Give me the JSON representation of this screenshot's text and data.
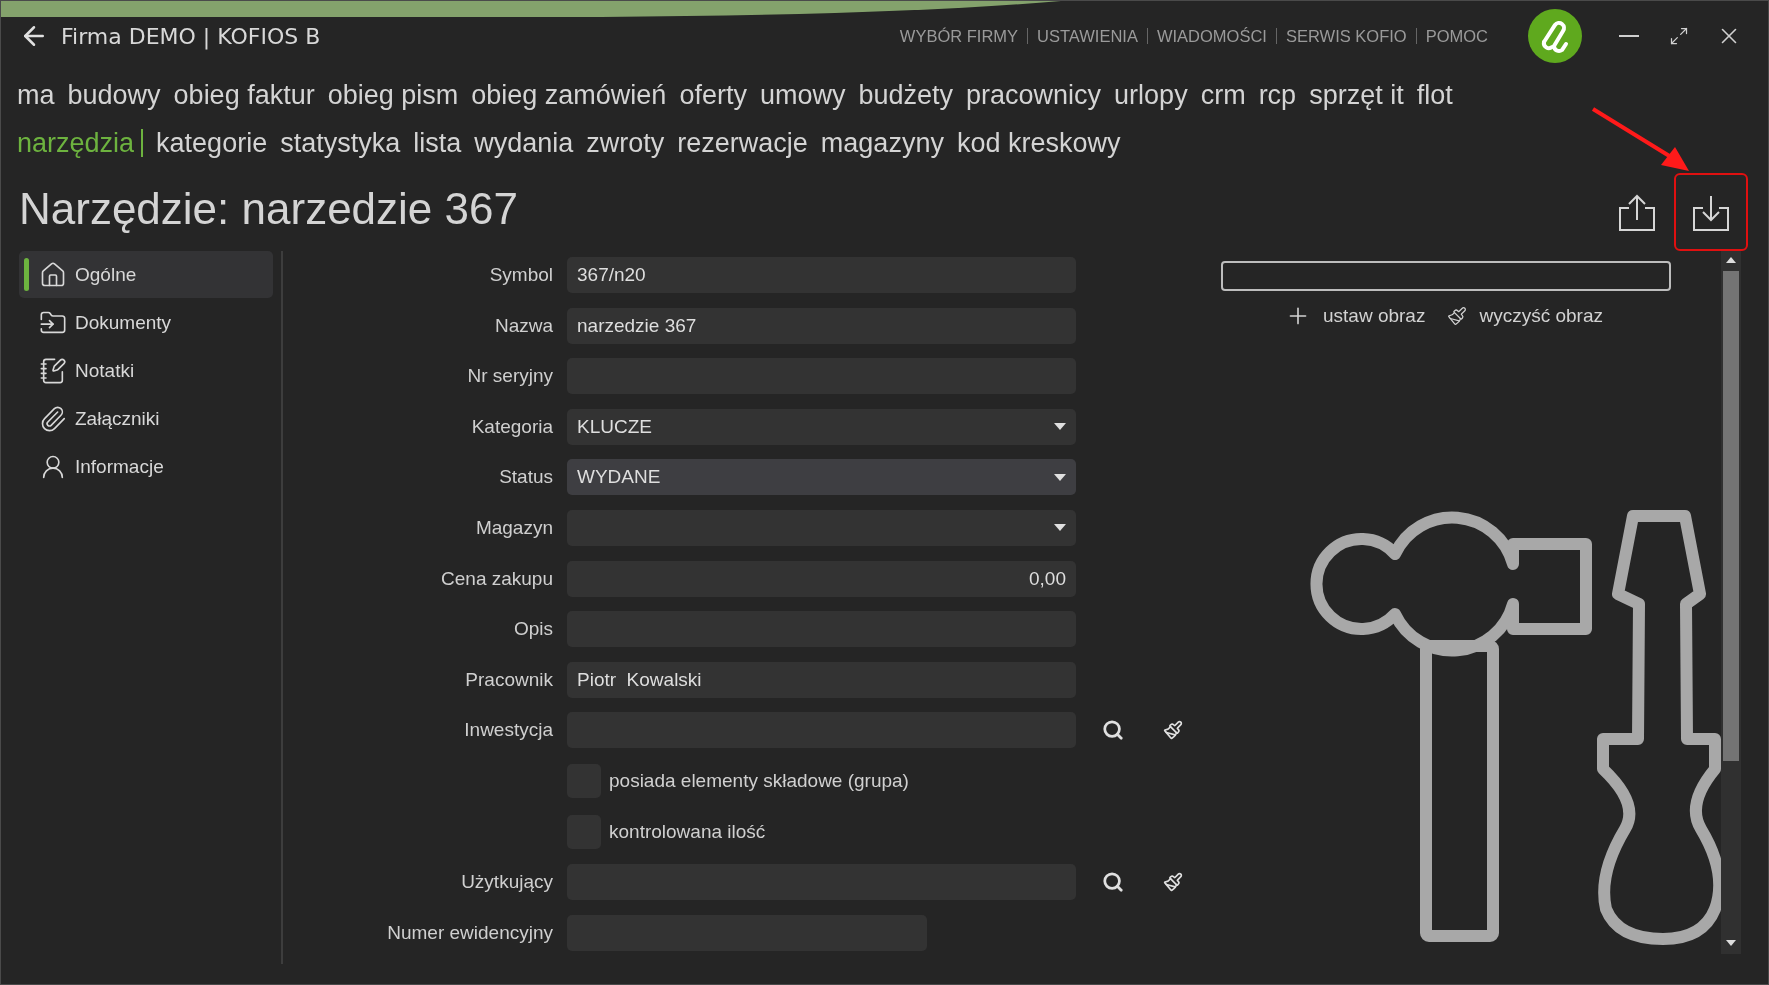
{
  "window": {
    "title": "Firma DEMO | KOFIOS B"
  },
  "top_links": [
    "WYBÓR FIRMY",
    "USTAWIENIA",
    "WIADOMOŚCI",
    "SERWIS KOFIO",
    "POMOC"
  ],
  "modules": [
    "ma",
    "budowy",
    "obieg faktur",
    "obieg pism",
    "obieg zamówień",
    "oferty",
    "umowy",
    "budżety",
    "pracownicy",
    "urlopy",
    "crm",
    "rcp",
    "sprzęt it",
    "flot"
  ],
  "submodules": {
    "current": "narzędzia",
    "items": [
      "kategorie",
      "statystyka",
      "lista",
      "wydania",
      "zwroty",
      "rezerwacje",
      "magazyny",
      "kod kreskowy"
    ]
  },
  "heading": "Narzędzie: narzedzie 367",
  "toolbar": [
    {
      "kind": "export",
      "highlighted": false
    },
    {
      "kind": "import",
      "highlighted": true
    }
  ],
  "sidebar": {
    "items": [
      {
        "label": "Ogólne",
        "selected": true
      },
      {
        "label": "Dokumenty",
        "selected": false
      },
      {
        "label": "Notatki",
        "selected": false
      },
      {
        "label": "Załączniki",
        "selected": false
      },
      {
        "label": "Informacje",
        "selected": false
      }
    ]
  },
  "form": {
    "fields": [
      {
        "kind": "text",
        "label": "Symbol",
        "value": "367/n20",
        "focused": false
      },
      {
        "kind": "text",
        "label": "Nazwa",
        "value": "narzedzie 367",
        "focused": false
      },
      {
        "kind": "text",
        "label": "Nr seryjny",
        "focused": false
      },
      {
        "kind": "select",
        "label": "Kategoria",
        "value": "KLUCZE",
        "focused": false
      },
      {
        "kind": "select",
        "label": "Status",
        "value": "WYDANE",
        "focused": true
      },
      {
        "kind": "select",
        "label": "Magazyn",
        "focused": false
      },
      {
        "kind": "number",
        "label": "Cena zakupu",
        "value": "0,00",
        "focused": false
      },
      {
        "kind": "text",
        "label": "Opis",
        "focused": false
      },
      {
        "kind": "text",
        "label": "Pracownik",
        "value": "Piotr  Kowalski",
        "focused": false
      },
      {
        "kind": "lookup",
        "label": "Inwestycja",
        "focused": false
      },
      {
        "kind": "checkbox",
        "label": "posiada elementy składowe (grupa)",
        "checked": false
      },
      {
        "kind": "checkbox",
        "label": "kontrolowana ilość",
        "checked": false
      },
      {
        "kind": "lookup",
        "label": "Użytkujący",
        "focused": false
      },
      {
        "kind": "short",
        "label": "Numer ewidencyjny",
        "focused": false
      }
    ]
  },
  "image_panel": {
    "actions": [
      {
        "kind": "set",
        "label": "ustaw obraz"
      },
      {
        "kind": "clear",
        "label": "wyczyść obraz"
      }
    ]
  }
}
